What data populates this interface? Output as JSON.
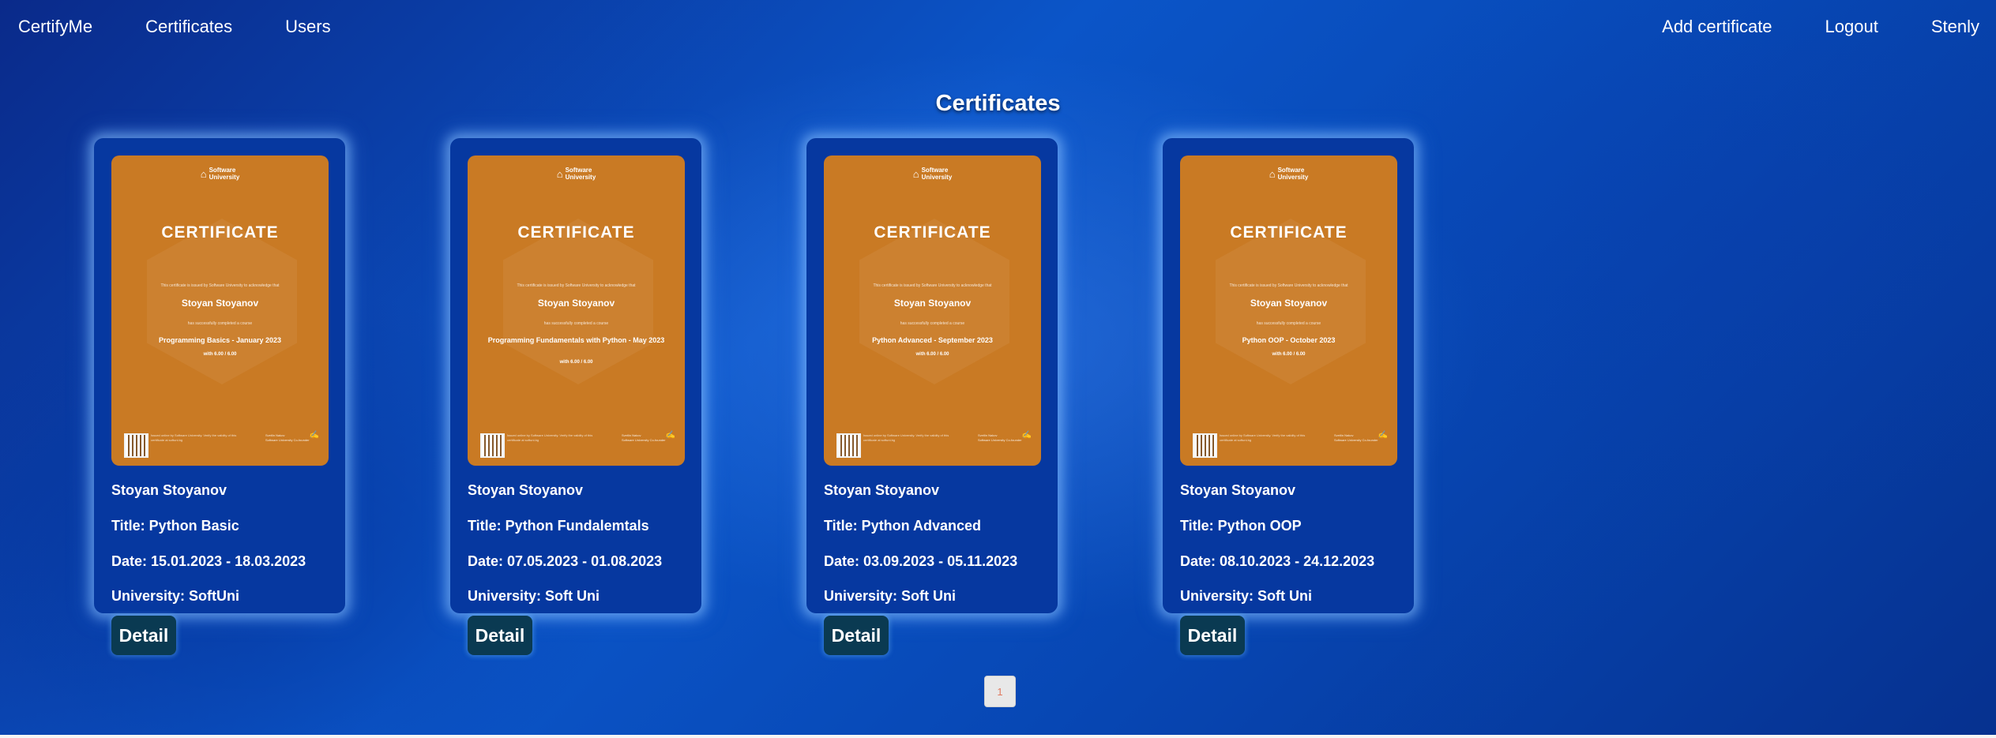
{
  "nav": {
    "brand": "CertifyMe",
    "certificates": "Certificates",
    "users": "Users",
    "add_certificate": "Add certificate",
    "logout": "Logout",
    "username": "Stenly"
  },
  "page": {
    "title": "Certificates"
  },
  "certificate_template": {
    "logo_line1": "Software",
    "logo_line2": "University",
    "heading": "CERTIFICATE",
    "issued_text": "This certificate is issued by Software University to acknowledge that",
    "completed_text": "has successfully completed a course",
    "grade_prefix": "with",
    "grade": "6.00 / 6.00",
    "verify_text": "Issued online by Software University. Verify the validity of this certificate at softuni.bg",
    "signer_name": "Svetlin Nakov",
    "signer_role": "Software University Co-founder"
  },
  "cards": [
    {
      "owner": "Stoyan Stoyanov",
      "cert_course": "Programming Basics - January 2023",
      "title": "Title: Python Basic",
      "date": "Date: 15.01.2023 - 18.03.2023",
      "university": "University: SoftUni",
      "detail_label": "Detail"
    },
    {
      "owner": "Stoyan Stoyanov",
      "cert_course": "Programming Fundamentals with Python - May 2023",
      "title": "Title: Python Fundalemtals",
      "date": "Date: 07.05.2023 - 01.08.2023",
      "university": "University: Soft Uni",
      "detail_label": "Detail"
    },
    {
      "owner": "Stoyan Stoyanov",
      "cert_course": "Python Advanced - September 2023",
      "title": "Title: Python Advanced",
      "date": "Date: 03.09.2023 - 05.11.2023",
      "university": "University: Soft Uni",
      "detail_label": "Detail"
    },
    {
      "owner": "Stoyan Stoyanov",
      "cert_course": "Python OOP - October 2023",
      "title": "Title: Python OOP",
      "date": "Date: 08.10.2023 - 24.12.2023",
      "university": "University: Soft Uni",
      "detail_label": "Detail"
    }
  ],
  "pagination": {
    "current_page": "1"
  },
  "colors": {
    "certificate_orange": "#c97a24",
    "card_blue": "#0638a0",
    "detail_button": "#0a3a52",
    "page_button_text": "#e07a5f"
  }
}
